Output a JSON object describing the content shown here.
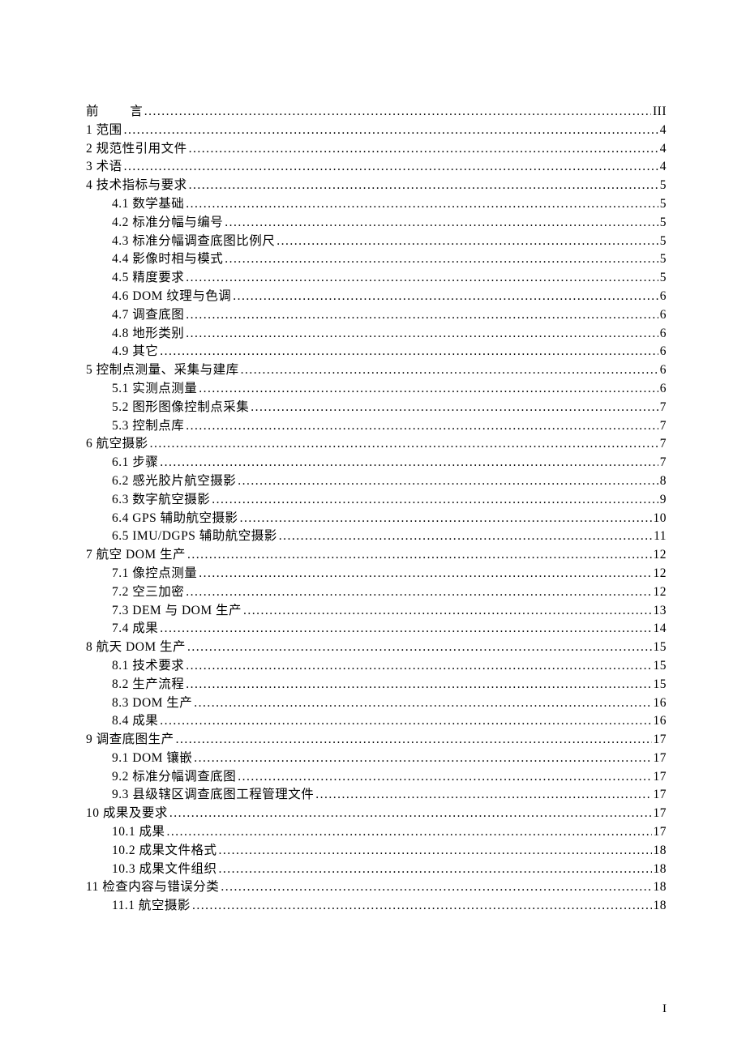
{
  "page_footer": "I",
  "entries": [
    {
      "label_parts": [
        "前",
        "言"
      ],
      "preface": true,
      "page": "III",
      "indent": 0
    },
    {
      "label": "1 范围",
      "page": "4",
      "indent": 0
    },
    {
      "label": "2 规范性引用文件",
      "page": "4",
      "indent": 0
    },
    {
      "label": "3 术语",
      "page": "4",
      "indent": 0
    },
    {
      "label": "4 技术指标与要求",
      "page": "5",
      "indent": 0
    },
    {
      "label": "4.1 数学基础",
      "page": "5",
      "indent": 1
    },
    {
      "label": "4.2 标准分幅与编号",
      "page": "5",
      "indent": 1
    },
    {
      "label": "4.3 标准分幅调查底图比例尺",
      "page": "5",
      "indent": 1
    },
    {
      "label": "4.4 影像时相与模式",
      "page": "5",
      "indent": 1
    },
    {
      "label": "4.5 精度要求",
      "page": "5",
      "indent": 1
    },
    {
      "label": "4.6 DOM 纹理与色调",
      "page": "6",
      "indent": 1
    },
    {
      "label": "4.7 调查底图",
      "page": "6",
      "indent": 1
    },
    {
      "label": "4.8 地形类别",
      "page": "6",
      "indent": 1
    },
    {
      "label": "4.9 其它",
      "page": "6",
      "indent": 1
    },
    {
      "label": "5 控制点测量、采集与建库",
      "page": "6",
      "indent": 0
    },
    {
      "label": "5.1 实测点测量",
      "page": "6",
      "indent": 1
    },
    {
      "label": "5.2 图形图像控制点采集",
      "page": "7",
      "indent": 1
    },
    {
      "label": "5.3 控制点库",
      "page": "7",
      "indent": 1
    },
    {
      "label": "6 航空摄影",
      "page": "7",
      "indent": 0
    },
    {
      "label": "6.1 步骤",
      "page": "7",
      "indent": 1
    },
    {
      "label": "6.2 感光胶片航空摄影",
      "page": "8",
      "indent": 1
    },
    {
      "label": "6.3 数字航空摄影",
      "page": "9",
      "indent": 1
    },
    {
      "label": "6.4 GPS 辅助航空摄影",
      "page": "10",
      "indent": 1
    },
    {
      "label": "6.5 IMU/DGPS 辅助航空摄影",
      "page": "11",
      "indent": 1
    },
    {
      "label": "7 航空 DOM 生产",
      "page": "12",
      "indent": 0
    },
    {
      "label": "7.1 像控点测量",
      "page": "12",
      "indent": 1
    },
    {
      "label": "7.2 空三加密",
      "page": "12",
      "indent": 1
    },
    {
      "label": "7.3 DEM 与 DOM 生产",
      "page": "13",
      "indent": 1
    },
    {
      "label": "7.4 成果",
      "page": "14",
      "indent": 1
    },
    {
      "label": "8 航天 DOM 生产",
      "page": "15",
      "indent": 0
    },
    {
      "label": "8.1 技术要求",
      "page": "15",
      "indent": 1
    },
    {
      "label": "8.2 生产流程",
      "page": "15",
      "indent": 1
    },
    {
      "label": "8.3 DOM 生产",
      "page": "16",
      "indent": 1
    },
    {
      "label": "8.4 成果",
      "page": "16",
      "indent": 1
    },
    {
      "label": "9 调查底图生产",
      "page": "17",
      "indent": 0
    },
    {
      "label": "9.1 DOM 镶嵌",
      "page": "17",
      "indent": 1
    },
    {
      "label": "9.2 标准分幅调查底图",
      "page": "17",
      "indent": 1
    },
    {
      "label": "9.3 县级辖区调查底图工程管理文件",
      "page": "17",
      "indent": 1
    },
    {
      "label": "10 成果及要求",
      "page": "17",
      "indent": 0
    },
    {
      "label": "10.1 成果",
      "page": "17",
      "indent": 1
    },
    {
      "label": "10.2 成果文件格式",
      "page": "18",
      "indent": 1
    },
    {
      "label": "10.3 成果文件组织",
      "page": "18",
      "indent": 1
    },
    {
      "label": "11 检查内容与错误分类",
      "page": "18",
      "indent": 0
    },
    {
      "label": "11.1 航空摄影",
      "page": "18",
      "indent": 1
    }
  ]
}
